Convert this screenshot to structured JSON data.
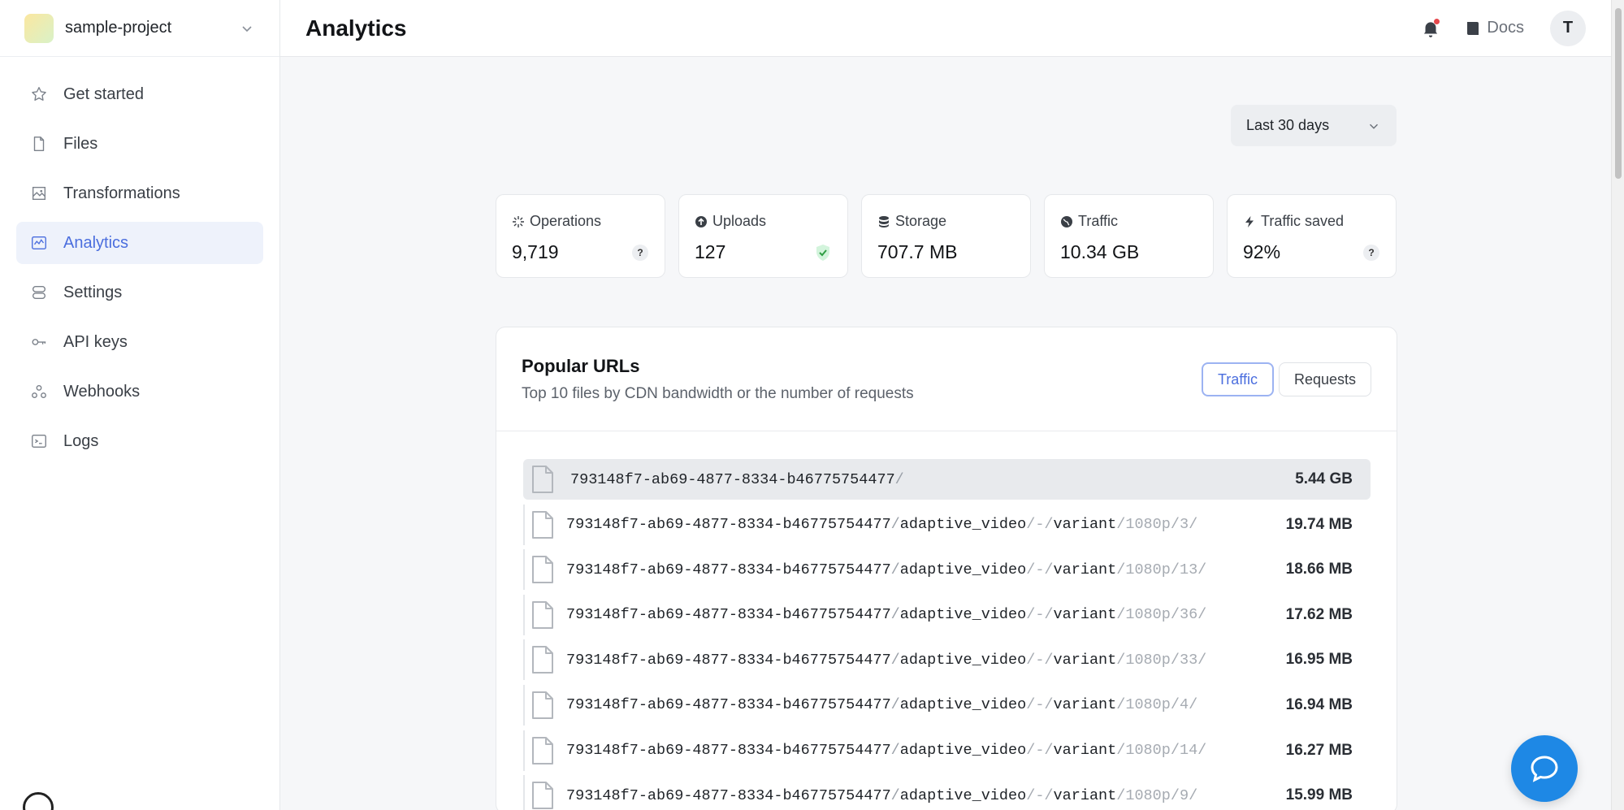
{
  "project": {
    "name": "sample-project"
  },
  "page": {
    "title": "Analytics"
  },
  "header": {
    "docs_label": "Docs",
    "avatar_initial": "T"
  },
  "sidebar": {
    "items": [
      {
        "label": "Get started",
        "icon": "star-icon",
        "active": false
      },
      {
        "label": "Files",
        "icon": "file-icon",
        "active": false
      },
      {
        "label": "Transformations",
        "icon": "image-transform-icon",
        "active": false
      },
      {
        "label": "Analytics",
        "icon": "analytics-icon",
        "active": true
      },
      {
        "label": "Settings",
        "icon": "settings-toggle-icon",
        "active": false
      },
      {
        "label": "API keys",
        "icon": "key-icon",
        "active": false
      },
      {
        "label": "Webhooks",
        "icon": "webhook-icon",
        "active": false
      },
      {
        "label": "Logs",
        "icon": "terminal-icon",
        "active": false
      }
    ]
  },
  "range": {
    "selected": "Last 30 days"
  },
  "stats": [
    {
      "label": "Operations",
      "value": "9,719",
      "icon": "sparkle-icon",
      "badge": "?"
    },
    {
      "label": "Uploads",
      "value": "127",
      "icon": "upload-circle-icon",
      "badge": "check"
    },
    {
      "label": "Storage",
      "value": "707.7 MB",
      "icon": "database-icon",
      "badge": ""
    },
    {
      "label": "Traffic",
      "value": "10.34 GB",
      "icon": "globe-icon",
      "badge": ""
    },
    {
      "label": "Traffic saved",
      "value": "92%",
      "icon": "bolt-icon",
      "badge": "?"
    }
  ],
  "popular": {
    "title": "Popular URLs",
    "subtitle": "Top 10 files by CDN bandwidth or the number of requests",
    "tabs": [
      {
        "label": "Traffic",
        "active": true
      },
      {
        "label": "Requests",
        "active": false
      }
    ],
    "rows": [
      {
        "uuid": "793148f7-ab69-4877-8334-b46775754477",
        "sep": "/",
        "path": "",
        "dash": "",
        "variant": "",
        "dim": "",
        "size": "5.44 GB"
      },
      {
        "uuid": "793148f7-ab69-4877-8334-b46775754477",
        "sep": "/",
        "path": "adaptive_video",
        "dash": "/-/",
        "variant": "variant",
        "dim": "/1080p/3/",
        "size": "19.74 MB"
      },
      {
        "uuid": "793148f7-ab69-4877-8334-b46775754477",
        "sep": "/",
        "path": "adaptive_video",
        "dash": "/-/",
        "variant": "variant",
        "dim": "/1080p/13/",
        "size": "18.66 MB"
      },
      {
        "uuid": "793148f7-ab69-4877-8334-b46775754477",
        "sep": "/",
        "path": "adaptive_video",
        "dash": "/-/",
        "variant": "variant",
        "dim": "/1080p/36/",
        "size": "17.62 MB"
      },
      {
        "uuid": "793148f7-ab69-4877-8334-b46775754477",
        "sep": "/",
        "path": "adaptive_video",
        "dash": "/-/",
        "variant": "variant",
        "dim": "/1080p/33/",
        "size": "16.95 MB"
      },
      {
        "uuid": "793148f7-ab69-4877-8334-b46775754477",
        "sep": "/",
        "path": "adaptive_video",
        "dash": "/-/",
        "variant": "variant",
        "dim": "/1080p/4/",
        "size": "16.94 MB"
      },
      {
        "uuid": "793148f7-ab69-4877-8334-b46775754477",
        "sep": "/",
        "path": "adaptive_video",
        "dash": "/-/",
        "variant": "variant",
        "dim": "/1080p/14/",
        "size": "16.27 MB"
      },
      {
        "uuid": "793148f7-ab69-4877-8334-b46775754477",
        "sep": "/",
        "path": "adaptive_video",
        "dash": "/-/",
        "variant": "variant",
        "dim": "/1080p/9/",
        "size": "15.99 MB"
      }
    ]
  }
}
